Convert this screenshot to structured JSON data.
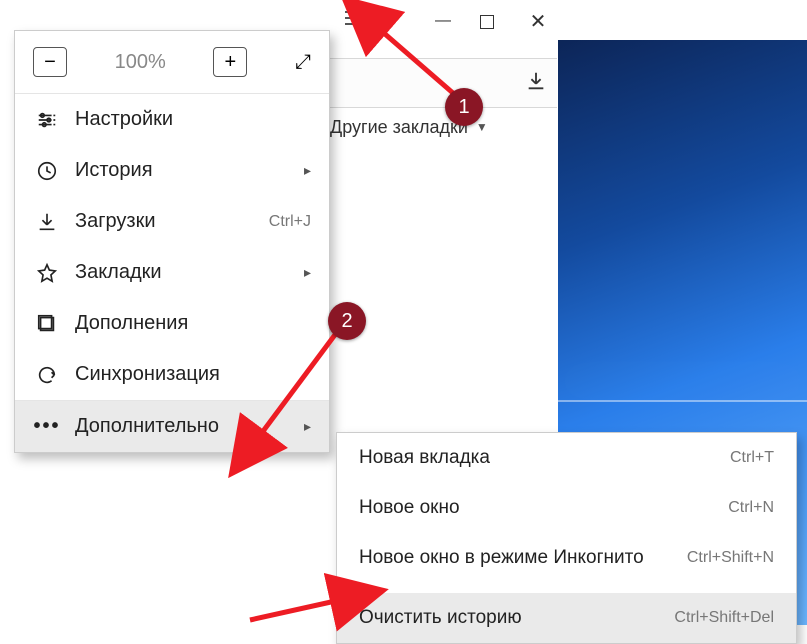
{
  "zoom": {
    "value": "100%"
  },
  "bookmarks_bar": {
    "other": "Другие закладки"
  },
  "menu": {
    "settings": "Настройки",
    "history": "История",
    "downloads": "Загрузки",
    "downloads_shortcut": "Ctrl+J",
    "bookmarks": "Закладки",
    "addons": "Дополнения",
    "sync": "Синхронизация",
    "more": "Дополнительно"
  },
  "submenu": {
    "new_tab": "Новая вкладка",
    "new_tab_shortcut": "Ctrl+T",
    "new_window": "Новое окно",
    "new_window_shortcut": "Ctrl+N",
    "incognito": "Новое окно в режиме Инкогнито",
    "incognito_shortcut": "Ctrl+Shift+N",
    "clear_history": "Очистить историю",
    "clear_history_shortcut": "Ctrl+Shift+Del"
  },
  "callouts": {
    "one": "1",
    "two": "2"
  }
}
